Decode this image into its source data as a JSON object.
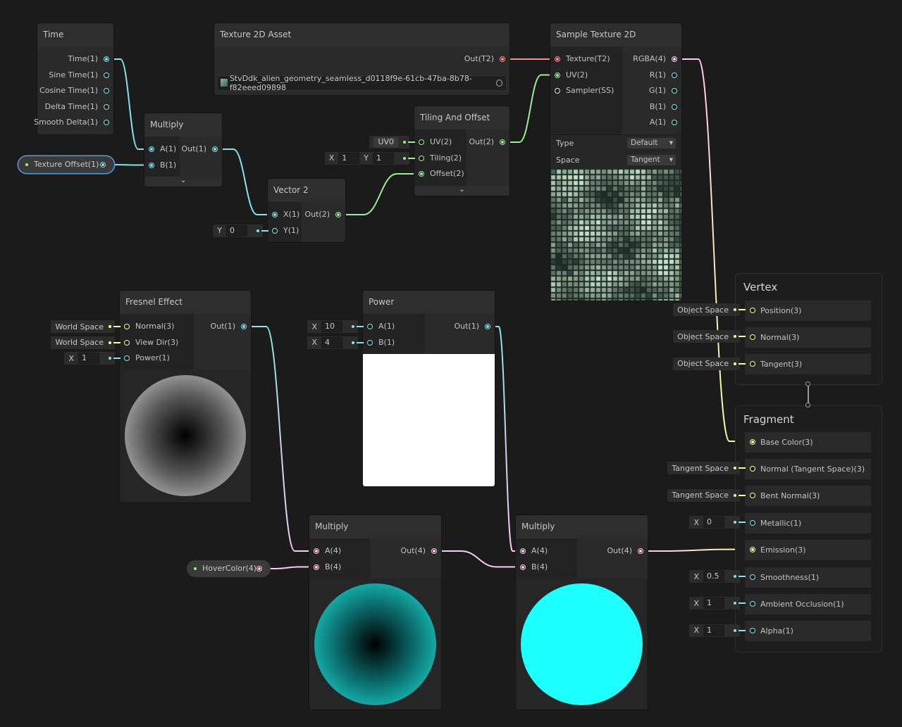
{
  "port_colors": {
    "float": "#84e4e7",
    "vec2": "#9aef92",
    "vec3": "#f6ff9a",
    "vec4": "#fbcbf4",
    "texture": "#ff8b8b",
    "sampler": "#e6e6e6"
  },
  "nodes": {
    "time": {
      "title": "Time",
      "inputs": [],
      "outputs": [
        {
          "label": "Time(1)",
          "type": "float",
          "connected": true
        },
        {
          "label": "Sine Time(1)",
          "type": "float"
        },
        {
          "label": "Cosine Time(1)",
          "type": "float"
        },
        {
          "label": "Delta Time(1)",
          "type": "float"
        },
        {
          "label": "Smooth Delta(1)",
          "type": "float"
        }
      ]
    },
    "multiply_a": {
      "title": "Multiply",
      "inputs": [
        {
          "label": "A(1)",
          "type": "float",
          "connected": true
        },
        {
          "label": "B(1)",
          "type": "float",
          "connected": true
        }
      ],
      "outputs": [
        {
          "label": "Out(1)",
          "type": "float",
          "connected": true
        }
      ]
    },
    "texture_asset": {
      "title": "Texture 2D Asset",
      "inputs": [],
      "outputs": [
        {
          "label": "Out(T2)",
          "type": "texture",
          "connected": true
        }
      ],
      "asset": "StvDdk_alien_geometry_seamless_d0118f9e-61cb-47ba-8b78-f82eeed09898"
    },
    "sample_texture": {
      "title": "Sample Texture 2D",
      "inputs": [
        {
          "label": "Texture(T2)",
          "type": "texture",
          "connected": true
        },
        {
          "label": "UV(2)",
          "type": "vec2",
          "connected": true
        },
        {
          "label": "Sampler(SS)",
          "type": "sampler"
        }
      ],
      "outputs": [
        {
          "label": "RGBA(4)",
          "type": "vec4",
          "connected": true
        },
        {
          "label": "R(1)",
          "type": "float"
        },
        {
          "label": "G(1)",
          "type": "float"
        },
        {
          "label": "B(1)",
          "type": "float"
        },
        {
          "label": "A(1)",
          "type": "float"
        }
      ],
      "settings": [
        {
          "label": "Type",
          "value": "Default"
        },
        {
          "label": "Space",
          "value": "Tangent"
        }
      ]
    },
    "tiling_offset": {
      "title": "Tiling And Offset",
      "inputs": [
        {
          "label": "UV(2)",
          "type": "vec2",
          "default": {
            "dropdown": "UV0"
          }
        },
        {
          "label": "Tiling(2)",
          "type": "vec2",
          "default": {
            "fields": [
              {
                "label": "X",
                "value": "1"
              },
              {
                "label": "Y",
                "value": "1"
              }
            ]
          }
        },
        {
          "label": "Offset(2)",
          "type": "vec2",
          "connected": true
        }
      ],
      "outputs": [
        {
          "label": "Out(2)",
          "type": "vec2",
          "connected": true
        }
      ]
    },
    "vector2": {
      "title": "Vector 2",
      "inputs": [
        {
          "label": "X(1)",
          "type": "float",
          "connected": true
        },
        {
          "label": "Y(1)",
          "type": "float",
          "default": {
            "fields": [
              {
                "label": "Y",
                "value": "0"
              }
            ]
          }
        }
      ],
      "outputs": [
        {
          "label": "Out(2)",
          "type": "vec2",
          "connected": true
        }
      ]
    },
    "fresnel": {
      "title": "Fresnel Effect",
      "inputs": [
        {
          "label": "Normal(3)",
          "type": "vec3",
          "default": {
            "text": "World Space"
          }
        },
        {
          "label": "View Dir(3)",
          "type": "vec3",
          "default": {
            "text": "World Space"
          }
        },
        {
          "label": "Power(1)",
          "type": "float",
          "default": {
            "fields": [
              {
                "label": "X",
                "value": "1"
              }
            ]
          }
        }
      ],
      "outputs": [
        {
          "label": "Out(1)",
          "type": "float",
          "connected": true
        }
      ]
    },
    "power": {
      "title": "Power",
      "inputs": [
        {
          "label": "A(1)",
          "type": "float",
          "default": {
            "fields": [
              {
                "label": "X",
                "value": "10"
              }
            ]
          }
        },
        {
          "label": "B(1)",
          "type": "float",
          "default": {
            "fields": [
              {
                "label": "X",
                "value": "4"
              }
            ]
          }
        }
      ],
      "outputs": [
        {
          "label": "Out(1)",
          "type": "float",
          "connected": true
        }
      ]
    },
    "multiply_b": {
      "title": "Multiply",
      "inputs": [
        {
          "label": "A(4)",
          "type": "vec4",
          "connected": true
        },
        {
          "label": "B(4)",
          "type": "vec4",
          "connected": true
        }
      ],
      "outputs": [
        {
          "label": "Out(4)",
          "type": "vec4",
          "connected": true
        }
      ]
    },
    "multiply_c": {
      "title": "Multiply",
      "inputs": [
        {
          "label": "A(4)",
          "type": "vec4",
          "connected": true
        },
        {
          "label": "B(4)",
          "type": "vec4",
          "connected": true
        }
      ],
      "outputs": [
        {
          "label": "Out(4)",
          "type": "vec4",
          "connected": true
        }
      ]
    }
  },
  "properties": {
    "texture_offset": {
      "label": "Texture Offset(1)",
      "type": "float",
      "selected": true
    },
    "hover_color": {
      "label": "HoverColor(4)",
      "type": "vec4"
    }
  },
  "master": {
    "vertex": {
      "title": "Vertex",
      "slots": [
        {
          "label": "Position(3)",
          "type": "vec3",
          "default": {
            "text": "Object Space"
          }
        },
        {
          "label": "Normal(3)",
          "type": "vec3",
          "default": {
            "text": "Object Space"
          }
        },
        {
          "label": "Tangent(3)",
          "type": "vec3",
          "default": {
            "text": "Object Space"
          }
        }
      ]
    },
    "fragment": {
      "title": "Fragment",
      "slots": [
        {
          "label": "Base Color(3)",
          "type": "vec3",
          "connected": true
        },
        {
          "label": "Normal (Tangent Space)(3)",
          "type": "vec3",
          "default": {
            "text": "Tangent Space"
          }
        },
        {
          "label": "Bent Normal(3)",
          "type": "vec3",
          "default": {
            "text": "Tangent Space"
          }
        },
        {
          "label": "Metallic(1)",
          "type": "float",
          "default": {
            "fields": [
              {
                "label": "X",
                "value": "0"
              }
            ]
          }
        },
        {
          "label": "Emission(3)",
          "type": "vec3",
          "connected": true
        },
        {
          "label": "Smoothness(1)",
          "type": "float",
          "default": {
            "fields": [
              {
                "label": "X",
                "value": "0.5"
              }
            ]
          }
        },
        {
          "label": "Ambient Occlusion(1)",
          "type": "float",
          "default": {
            "fields": [
              {
                "label": "X",
                "value": "1"
              }
            ]
          }
        },
        {
          "label": "Alpha(1)",
          "type": "float",
          "default": {
            "fields": [
              {
                "label": "X",
                "value": "1"
              }
            ]
          }
        }
      ]
    }
  },
  "edges": [
    {
      "from": "time.out.0",
      "to": "multiply_a.in.0"
    },
    {
      "from": "prop.texture_offset",
      "to": "multiply_a.in.1"
    },
    {
      "from": "multiply_a.out.0",
      "to": "vector2.in.0"
    },
    {
      "from": "vector2.out.0",
      "to": "tiling_offset.in.2"
    },
    {
      "from": "tiling_offset.out.0",
      "to": "sample_texture.in.1"
    },
    {
      "from": "texture_asset.out.0",
      "to": "sample_texture.in.0"
    },
    {
      "from": "sample_texture.out.0",
      "to": "fragment.in.0"
    },
    {
      "from": "fresnel.out.0",
      "to": "multiply_b.in.0"
    },
    {
      "from": "prop.hover_color",
      "to": "multiply_b.in.1"
    },
    {
      "from": "multiply_b.out.0",
      "to": "multiply_c.in.1"
    },
    {
      "from": "power.out.0",
      "to": "multiply_c.in.0"
    },
    {
      "from": "multiply_c.out.0",
      "to": "fragment.in.4"
    }
  ]
}
